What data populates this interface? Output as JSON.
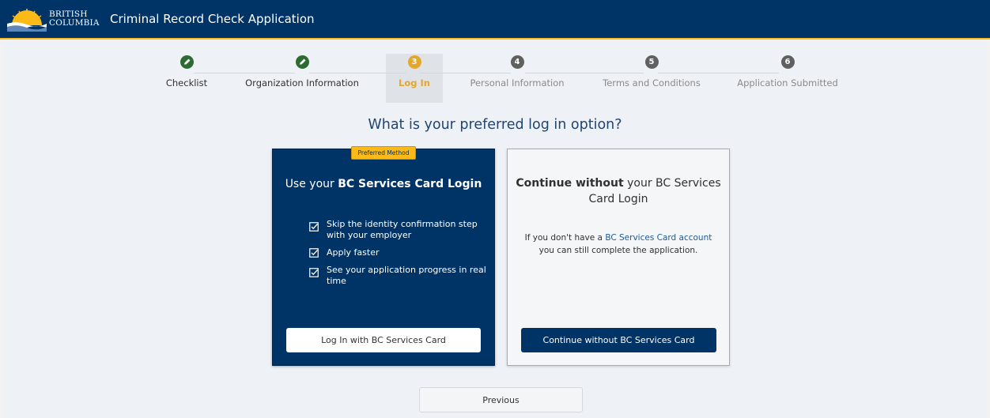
{
  "header": {
    "logo_text_line1": "BRITISH",
    "logo_text_line2": "COLUMBIA",
    "app_title": "Criminal Record Check Application"
  },
  "stepper": {
    "steps": [
      {
        "number": "1",
        "label": "Checklist",
        "status": "done",
        "icon": "pencil-check-icon"
      },
      {
        "number": "2",
        "label": "Organization Information",
        "status": "done",
        "icon": "pencil-check-icon"
      },
      {
        "number": "3",
        "label": "Log In",
        "status": "current"
      },
      {
        "number": "4",
        "label": "Personal Information",
        "status": "todo"
      },
      {
        "number": "5",
        "label": "Terms and Conditions",
        "status": "todo"
      },
      {
        "number": "6",
        "label": "Application Submitted",
        "status": "todo"
      }
    ]
  },
  "main": {
    "question": "What is your preferred log in option?",
    "preferred_card": {
      "badge": "Preferred Method",
      "title_prefix": "Use your ",
      "title_bold": "BC Services Card Login",
      "benefits": [
        "Skip the identity confirmation step with your employer",
        "Apply faster",
        "See your application progress in real time"
      ],
      "button_label": "Log In with BC Services Card"
    },
    "alt_card": {
      "title_bold": "Continue without",
      "title_rest": " your BC Services Card Login",
      "desc_prefix": "If you don't have a ",
      "desc_link": "BC Services Card account",
      "desc_suffix": " you can still complete the application.",
      "button_label": "Continue without BC Services Card"
    },
    "previous_label": "Previous"
  },
  "colors": {
    "brand_blue": "#003366",
    "brand_gold": "#fcba19",
    "done_green": "#2e6b32",
    "current_amber": "#e3a82b",
    "link_blue": "#1a5a96"
  }
}
